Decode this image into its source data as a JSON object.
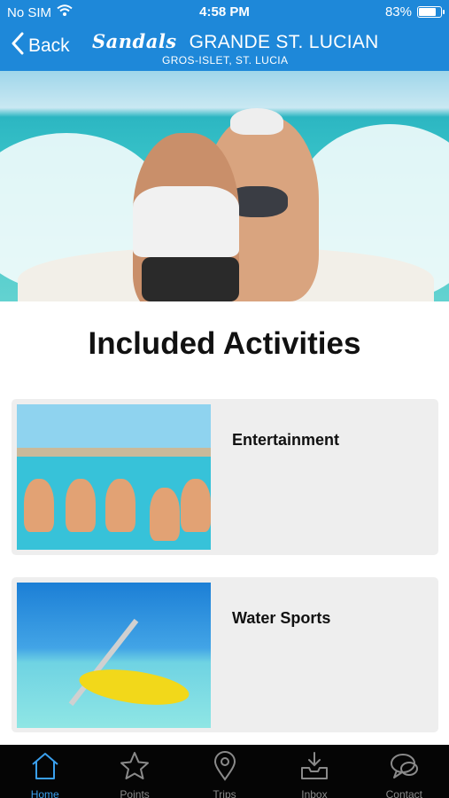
{
  "status_bar": {
    "carrier": "No SIM",
    "time": "4:58 PM",
    "battery_text": "83%",
    "battery_level": 0.83,
    "wifi_icon": "wifi-icon"
  },
  "header": {
    "back_label": "Back",
    "brand_logo": "Sandals",
    "resort_name": "GRANDE ST. LUCIAN",
    "location": "GROS-ISLET, ST. LUCIA",
    "color": "#1e88d9"
  },
  "page": {
    "title": "Included Activities"
  },
  "activities": [
    {
      "label": "Entertainment"
    },
    {
      "label": "Water Sports"
    }
  ],
  "tab_bar": {
    "active_color": "#3aa0ee",
    "inactive_color": "#8a8a8a",
    "items": [
      {
        "label": "Home",
        "icon": "home-icon",
        "active": true
      },
      {
        "label": "Points",
        "icon": "star-icon",
        "active": false
      },
      {
        "label": "Trips",
        "icon": "map-pin-icon",
        "active": false
      },
      {
        "label": "Inbox",
        "icon": "inbox-icon",
        "active": false
      },
      {
        "label": "Contact",
        "icon": "chat-bubble-icon",
        "active": false
      }
    ]
  }
}
